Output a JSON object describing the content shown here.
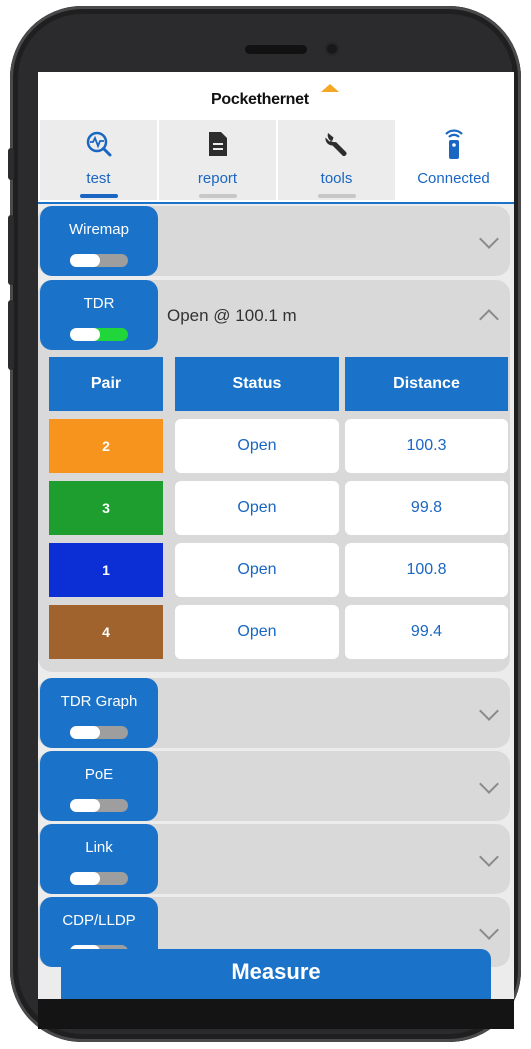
{
  "app": {
    "logo_text": "Pockethernet"
  },
  "tabs": [
    {
      "label": "test",
      "icon": "pulse-magnifier-icon",
      "active": true
    },
    {
      "label": "report",
      "icon": "document-icon",
      "active": false
    },
    {
      "label": "tools",
      "icon": "wrench-icon",
      "active": false
    },
    {
      "label": "Connected",
      "icon": "remote-device-icon",
      "active": false
    }
  ],
  "sections": {
    "wiremap": {
      "label": "Wiremap",
      "enabled": false
    },
    "tdr": {
      "label": "TDR",
      "enabled": true,
      "summary": "Open @ 100.1 m",
      "expanded": true
    },
    "tdr_graph": {
      "label": "TDR Graph",
      "enabled": false
    },
    "poe": {
      "label": "PoE",
      "enabled": false
    },
    "link": {
      "label": "Link",
      "enabled": false
    },
    "cdp_lldp": {
      "label": "CDP/LLDP",
      "enabled": false
    }
  },
  "tdr_table": {
    "headers": [
      "Pair",
      "Status",
      "Distance"
    ],
    "rows": [
      {
        "pair": "2",
        "color": "#f7941d",
        "status": "Open",
        "distance": "100.3"
      },
      {
        "pair": "3",
        "color": "#1e9e2e",
        "status": "Open",
        "distance": "99.8"
      },
      {
        "pair": "1",
        "color": "#0b2fd4",
        "status": "Open",
        "distance": "100.8"
      },
      {
        "pair": "4",
        "color": "#a0632e",
        "status": "Open",
        "distance": "99.4"
      }
    ]
  },
  "measure": {
    "label": "Measure"
  },
  "colors": {
    "accent": "#1a73c8",
    "toggle_on": "#21d63a"
  }
}
